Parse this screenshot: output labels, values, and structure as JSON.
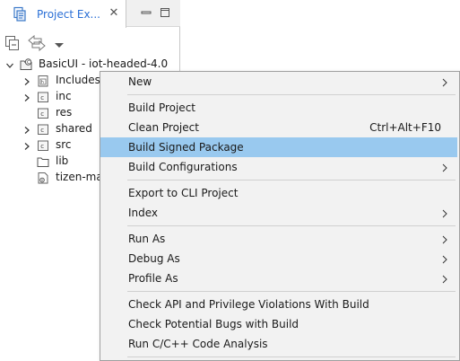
{
  "explorer": {
    "tab_title": "Project Ex...",
    "close_glyph": "✕",
    "tree": {
      "root": {
        "label": "BasicUI - iot-headed-4.0",
        "icon": "project-icon"
      },
      "children": [
        {
          "label": "Includes",
          "icon": "includes-icon",
          "expandable": true
        },
        {
          "label": "inc",
          "icon": "source-folder-icon",
          "expandable": true
        },
        {
          "label": "res",
          "icon": "source-folder-icon",
          "expandable": false
        },
        {
          "label": "shared",
          "icon": "source-folder-icon",
          "expandable": true
        },
        {
          "label": "src",
          "icon": "source-folder-icon",
          "expandable": true
        },
        {
          "label": "lib",
          "icon": "folder-icon",
          "expandable": false
        },
        {
          "label": "tizen-ma",
          "icon": "manifest-file-icon",
          "expandable": false
        }
      ]
    }
  },
  "context_menu": {
    "items": [
      {
        "label": "New",
        "submenu": true
      },
      {
        "label": "Build Project"
      },
      {
        "label": "Clean Project",
        "accelerator": "Ctrl+Alt+F10"
      },
      {
        "label": "Build Signed Package",
        "highlighted": true
      },
      {
        "label": "Build Configurations",
        "submenu": true
      },
      {
        "label": "Export to CLI Project"
      },
      {
        "label": "Index",
        "submenu": true
      },
      {
        "label": "Run As",
        "submenu": true
      },
      {
        "label": "Debug As",
        "submenu": true
      },
      {
        "label": "Profile As",
        "submenu": true
      },
      {
        "label": "Check API and Privilege Violations With Build"
      },
      {
        "label": "Check Potential Bugs with Build"
      },
      {
        "label": "Run C/C++ Code Analysis"
      }
    ]
  },
  "colors": {
    "tab_title": "#2a6fd6",
    "menu_highlight": "#99c9ef",
    "menu_background": "#f2f2f2"
  }
}
